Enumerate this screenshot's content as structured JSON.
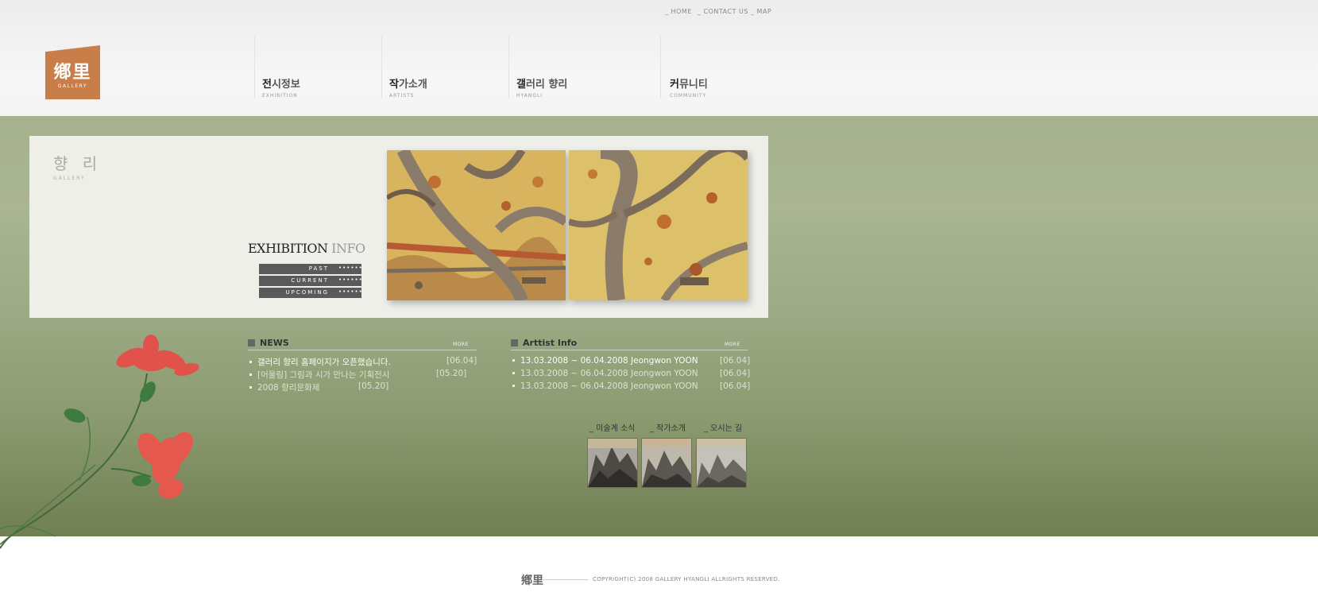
{
  "top_links": [
    {
      "label": "HOME"
    },
    {
      "label": "CONTACT US"
    },
    {
      "label": "MAP"
    }
  ],
  "logo": {
    "hanja": "鄕里",
    "sub": "GALLERY"
  },
  "nav": [
    {
      "first": "전",
      "rest": "시정보",
      "en": "EXHIBITION"
    },
    {
      "first": "작",
      "rest": "가소개",
      "en": "ARTISTS"
    },
    {
      "first": "갤",
      "rest": "러리 향리",
      "en": "HYANGLI"
    },
    {
      "first": "커",
      "rest": "뮤니티",
      "en": "COMMUNITY"
    }
  ],
  "panel": {
    "brand_ko": "향 리",
    "brand_en": "GALLERY",
    "title_main": "EXHIBITION",
    "title_accent": "INFO",
    "buttons": [
      {
        "label": "PAST"
      },
      {
        "label": "CURRENT"
      },
      {
        "label": "UPCOMING"
      }
    ],
    "dots": "••••••"
  },
  "news": {
    "title": "NEWS",
    "more": "MORE",
    "items": [
      {
        "text": "갤러리 향리 홈페이지가 오픈했습니다.",
        "date": "[06.04]"
      },
      {
        "text": "[어울림] 그림과 시가 만나는 기획전시",
        "date": "[05.20]"
      },
      {
        "text": "2008 향리문화제",
        "date": "[05.20]"
      }
    ]
  },
  "artist": {
    "title": "Arttist Info",
    "more": "MORE",
    "items": [
      {
        "text": "13.03.2008 ~ 06.04.2008 Jeongwon YOON",
        "date": "[06.04]"
      },
      {
        "text": "13.03.2008 ~ 06.04.2008 Jeongwon YOON",
        "date": "[06.04]"
      },
      {
        "text": "13.03.2008 ~ 06.04.2008 Jeongwon YOON",
        "date": "[06.04]"
      }
    ]
  },
  "thumbs": [
    {
      "label": "_ 미술계 소식"
    },
    {
      "label": "_ 작가소개"
    },
    {
      "label": "_ 오시는 길"
    }
  ],
  "footer": {
    "logo": "鄕里",
    "copyright": "COPYRIGHT(C) 2008 GALLERY HYANGLI ALLRIGHTS RESERVED."
  },
  "colors": {
    "brand": "#c97e4a",
    "green_top": "#a6b190",
    "green_bottom": "#6f7f52",
    "flower": "#e0524a"
  }
}
